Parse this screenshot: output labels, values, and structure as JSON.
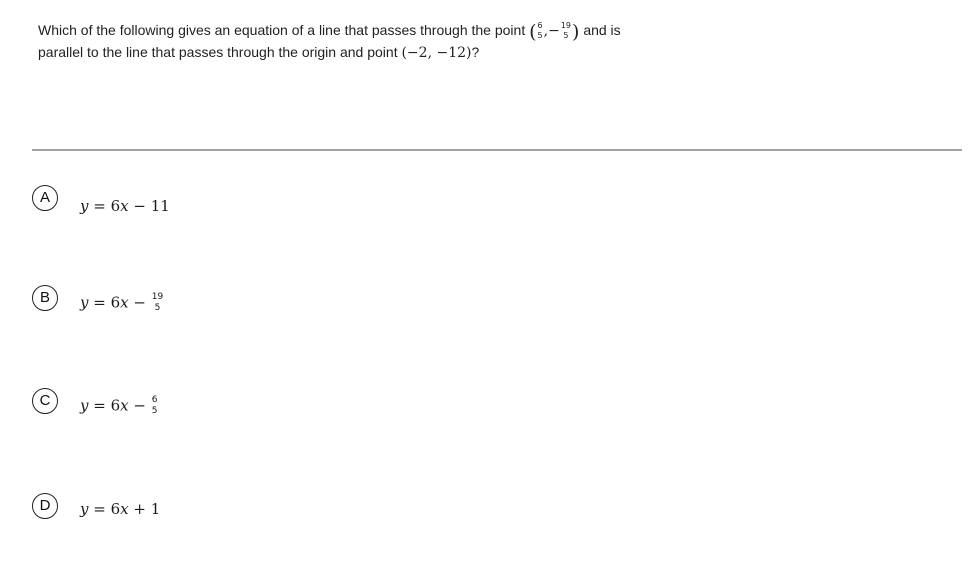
{
  "question": {
    "text_before_point": "Which of the following gives an equation of a line that passes through the point",
    "point_x": {
      "numerator": "6",
      "denominator": "5"
    },
    "point_y": {
      "sign": "−",
      "numerator": "19",
      "denominator": "5"
    },
    "text_after_point": "and is",
    "line2": "parallel to the line that passes through the origin and point",
    "line2_point": "(−2, −12)",
    "line2_end": "?"
  },
  "choices": [
    {
      "letter": "A",
      "lhs": "y",
      "eq": " = 6",
      "var": "x",
      "rest": " − 11",
      "fraction": null
    },
    {
      "letter": "B",
      "lhs": "y",
      "eq": " = 6",
      "var": "x",
      "rest": " − ",
      "fraction": {
        "numerator": "19",
        "denominator": "5"
      }
    },
    {
      "letter": "C",
      "lhs": "y",
      "eq": " = 6",
      "var": "x",
      "rest": " − ",
      "fraction": {
        "numerator": "6",
        "denominator": "5"
      }
    },
    {
      "letter": "D",
      "lhs": "y",
      "eq": " = 6",
      "var": "x",
      "rest": " + 1",
      "fraction": null
    }
  ]
}
